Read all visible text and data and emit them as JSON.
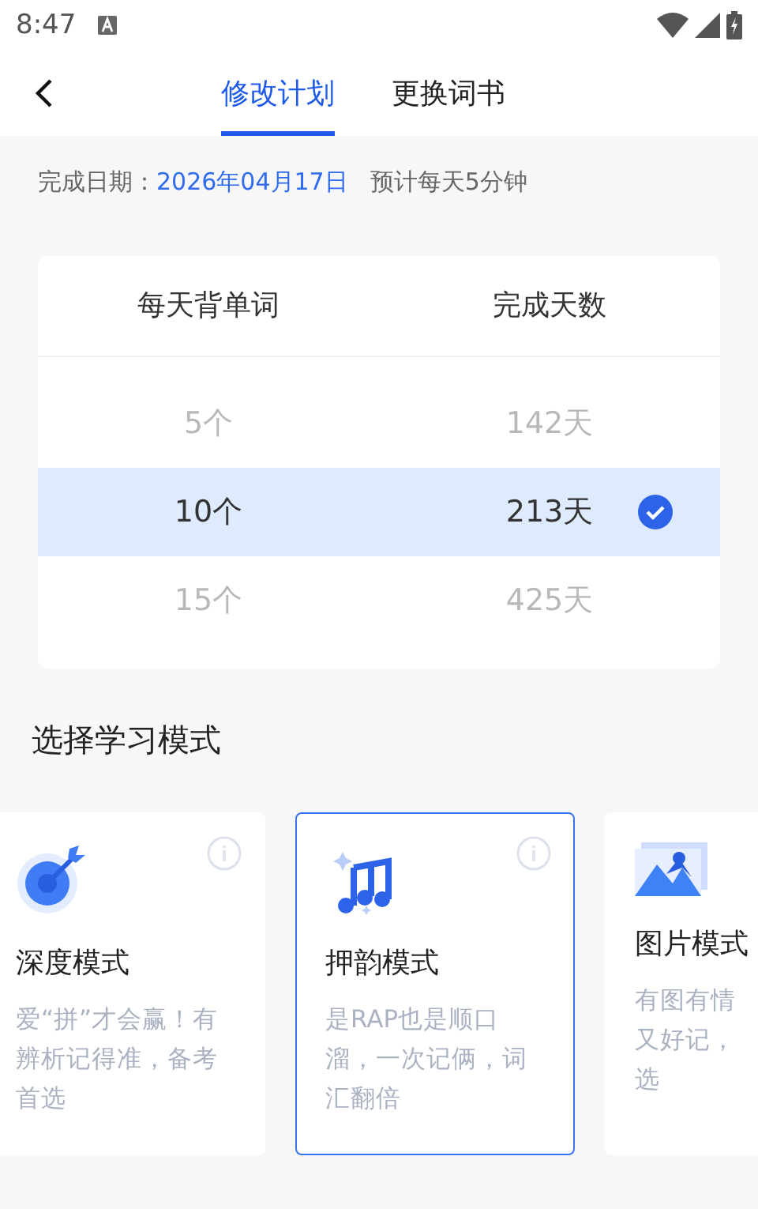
{
  "status_bar": {
    "time": "8:47"
  },
  "tabs": [
    {
      "label": "修改计划",
      "selected": true
    },
    {
      "label": "更换词书",
      "selected": false
    }
  ],
  "plan_info": {
    "label": "完成日期：",
    "date": "2026年04月17日",
    "estimate": "预计每天5分钟"
  },
  "picker": {
    "columns": [
      "每天背单词",
      "完成天数"
    ],
    "rows": [
      {
        "words": "5个",
        "days": "142天",
        "selected": false
      },
      {
        "words": "10个",
        "days": "213天",
        "selected": true
      },
      {
        "words": "15个",
        "days": "425天",
        "selected": false
      }
    ]
  },
  "section_title": "选择学习模式",
  "modes": [
    {
      "kind": "target",
      "title": "深度模式",
      "description_lines": [
        "爱“拼”才会赢！有",
        "辨析记得准，备考",
        "首选"
      ],
      "selected": false,
      "info": true
    },
    {
      "kind": "music",
      "title": "押韵模式",
      "description_lines": [
        "是RAP也是顺口",
        "溜，一次记俩，词",
        "汇翻倍"
      ],
      "selected": true,
      "info": true
    },
    {
      "kind": "image",
      "title": "图片模式",
      "description_lines": [
        "有图有情",
        "又好记，",
        "选"
      ],
      "selected": false,
      "info": false
    }
  ]
}
